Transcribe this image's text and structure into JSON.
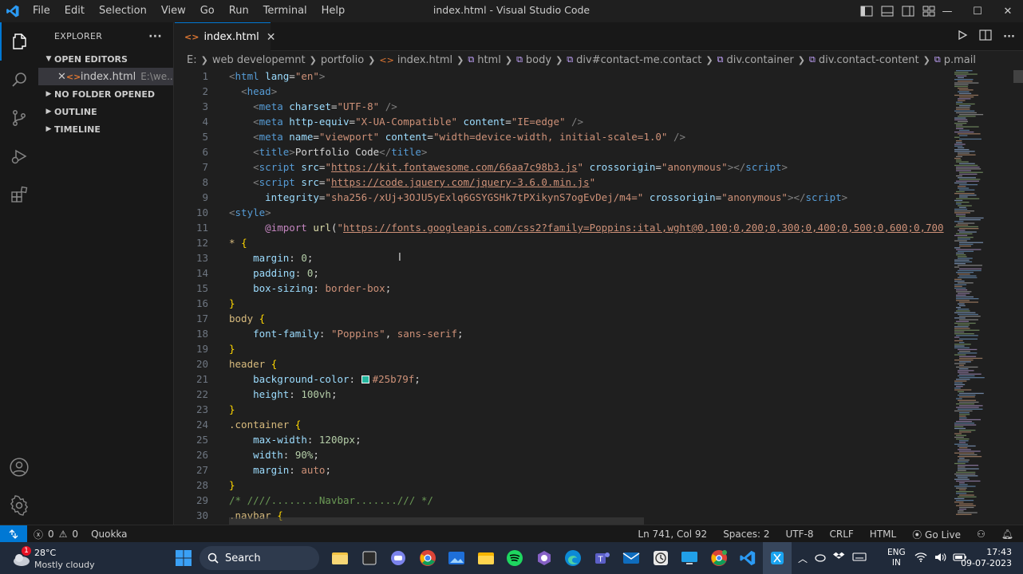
{
  "window": {
    "title": "index.html - Visual Studio Code",
    "menu": [
      "File",
      "Edit",
      "Selection",
      "View",
      "Go",
      "Run",
      "Terminal",
      "Help"
    ],
    "controls": {
      "minimize": "—",
      "maximize": "☐",
      "close": "✕"
    }
  },
  "sidebar": {
    "header": "EXPLORER",
    "more": "···",
    "open_editors": "OPEN EDITORS",
    "open_file": {
      "name": "index.html",
      "path": "E:\\we..."
    },
    "sections": [
      "NO FOLDER OPENED",
      "OUTLINE",
      "TIMELINE"
    ]
  },
  "tab": {
    "name": "index.html",
    "close": "✕"
  },
  "breadcrumb": [
    "E:",
    "web developemnt",
    "portfolio",
    "index.html",
    "html",
    "body",
    "div#contact-me.contact",
    "div.container",
    "div.contact-content",
    "p.mail"
  ],
  "editor": {
    "line_numbers": [
      "1",
      "2",
      "3",
      "4",
      "5",
      "6",
      "7",
      "8",
      "9",
      "10",
      "11",
      "12",
      "13",
      "14",
      "15",
      "16",
      "17",
      "18",
      "19",
      "20",
      "21",
      "22",
      "23",
      "24",
      "25",
      "26",
      "27",
      "28",
      "29",
      "30"
    ],
    "code": [
      [
        [
          "tb",
          "<"
        ],
        [
          "tg",
          "html"
        ],
        [
          "tx",
          " "
        ],
        [
          "at",
          "lang"
        ],
        [
          "tx",
          "="
        ],
        [
          "st",
          "\"en\""
        ],
        [
          "tb",
          ">"
        ]
      ],
      [
        [
          "tx",
          "  "
        ],
        [
          "tb",
          "<"
        ],
        [
          "tg",
          "head"
        ],
        [
          "tb",
          ">"
        ]
      ],
      [
        [
          "tx",
          "    "
        ],
        [
          "tb",
          "<"
        ],
        [
          "tg",
          "meta"
        ],
        [
          "tx",
          " "
        ],
        [
          "at",
          "charset"
        ],
        [
          "tx",
          "="
        ],
        [
          "st",
          "\"UTF-8\""
        ],
        [
          "tx",
          " "
        ],
        [
          "tb",
          "/>"
        ]
      ],
      [
        [
          "tx",
          "    "
        ],
        [
          "tb",
          "<"
        ],
        [
          "tg",
          "meta"
        ],
        [
          "tx",
          " "
        ],
        [
          "at",
          "http-equiv"
        ],
        [
          "tx",
          "="
        ],
        [
          "st",
          "\"X-UA-Compatible\""
        ],
        [
          "tx",
          " "
        ],
        [
          "at",
          "content"
        ],
        [
          "tx",
          "="
        ],
        [
          "st",
          "\"IE=edge\""
        ],
        [
          "tx",
          " "
        ],
        [
          "tb",
          "/>"
        ]
      ],
      [
        [
          "tx",
          "    "
        ],
        [
          "tb",
          "<"
        ],
        [
          "tg",
          "meta"
        ],
        [
          "tx",
          " "
        ],
        [
          "at",
          "name"
        ],
        [
          "tx",
          "="
        ],
        [
          "st",
          "\"viewport\""
        ],
        [
          "tx",
          " "
        ],
        [
          "at",
          "content"
        ],
        [
          "tx",
          "="
        ],
        [
          "st",
          "\"width=device-width, initial-scale=1.0\""
        ],
        [
          "tx",
          " "
        ],
        [
          "tb",
          "/>"
        ]
      ],
      [
        [
          "tx",
          "    "
        ],
        [
          "tb",
          "<"
        ],
        [
          "tg",
          "title"
        ],
        [
          "tb",
          ">"
        ],
        [
          "tx",
          "Portfolio Code"
        ],
        [
          "tb",
          "</"
        ],
        [
          "tg",
          "title"
        ],
        [
          "tb",
          ">"
        ]
      ],
      [
        [
          "tx",
          "    "
        ],
        [
          "tb",
          "<"
        ],
        [
          "tg",
          "script"
        ],
        [
          "tx",
          " "
        ],
        [
          "at",
          "src"
        ],
        [
          "tx",
          "="
        ],
        [
          "st",
          "\""
        ],
        [
          "lk",
          "https://kit.fontawesome.com/66aa7c98b3.js"
        ],
        [
          "st",
          "\""
        ],
        [
          "tx",
          " "
        ],
        [
          "at",
          "crossorigin"
        ],
        [
          "tx",
          "="
        ],
        [
          "st",
          "\"anonymous\""
        ],
        [
          "tb",
          "></"
        ],
        [
          "tg",
          "script"
        ],
        [
          "tb",
          ">"
        ]
      ],
      [
        [
          "tx",
          "    "
        ],
        [
          "tb",
          "<"
        ],
        [
          "tg",
          "script"
        ],
        [
          "tx",
          " "
        ],
        [
          "at",
          "src"
        ],
        [
          "tx",
          "="
        ],
        [
          "st",
          "\""
        ],
        [
          "lk",
          "https://code.jquery.com/jquery-3.6.0.min.js"
        ],
        [
          "st",
          "\""
        ]
      ],
      [
        [
          "tx",
          "      "
        ],
        [
          "at",
          "integrity"
        ],
        [
          "tx",
          "="
        ],
        [
          "st",
          "\"sha256-/xUj+3OJU5yExlq6GSYGSHk7tPXikynS7ogEvDej/m4=\""
        ],
        [
          "tx",
          " "
        ],
        [
          "at",
          "crossorigin"
        ],
        [
          "tx",
          "="
        ],
        [
          "st",
          "\"anonymous\""
        ],
        [
          "tb",
          "></"
        ],
        [
          "tg",
          "script"
        ],
        [
          "tb",
          ">"
        ]
      ],
      [
        [
          "tb",
          "<"
        ],
        [
          "tg",
          "style"
        ],
        [
          "tb",
          ">"
        ]
      ],
      [
        [
          "tx",
          "      "
        ],
        [
          "im",
          "@import"
        ],
        [
          "tx",
          " "
        ],
        [
          "fn",
          "url"
        ],
        [
          "tx",
          "("
        ],
        [
          "st",
          "\""
        ],
        [
          "lk",
          "https://fonts.googleapis.com/css2?family=Poppins:ital,wght@0,100;0,200;0,300;0,400;0,500;0,600;0,700"
        ]
      ],
      [
        [
          "sl",
          "*"
        ],
        [
          "tx",
          " "
        ],
        [
          "br",
          "{"
        ]
      ],
      [
        [
          "tx",
          "    "
        ],
        [
          "pr",
          "margin"
        ],
        [
          "tx",
          ": "
        ],
        [
          "nm",
          "0"
        ],
        [
          "tx",
          ";"
        ]
      ],
      [
        [
          "tx",
          "    "
        ],
        [
          "pr",
          "padding"
        ],
        [
          "tx",
          ": "
        ],
        [
          "nm",
          "0"
        ],
        [
          "tx",
          ";"
        ]
      ],
      [
        [
          "tx",
          "    "
        ],
        [
          "pr",
          "box-sizing"
        ],
        [
          "tx",
          ": "
        ],
        [
          "st",
          "border-box"
        ],
        [
          "tx",
          ";"
        ]
      ],
      [
        [
          "br",
          "}"
        ]
      ],
      [
        [
          "sl",
          "body"
        ],
        [
          "tx",
          " "
        ],
        [
          "br",
          "{"
        ]
      ],
      [
        [
          "tx",
          "    "
        ],
        [
          "pr",
          "font-family"
        ],
        [
          "tx",
          ": "
        ],
        [
          "st",
          "\"Poppins\""
        ],
        [
          "tx",
          ", "
        ],
        [
          "st",
          "sans-serif"
        ],
        [
          "tx",
          ";"
        ]
      ],
      [
        [
          "br",
          "}"
        ]
      ],
      [
        [
          "sl",
          "header"
        ],
        [
          "tx",
          " "
        ],
        [
          "br",
          "{"
        ]
      ],
      [
        [
          "tx",
          "    "
        ],
        [
          "pr",
          "background-color"
        ],
        [
          "tx",
          ": "
        ],
        [
          "sw",
          ""
        ],
        [
          "st",
          "#25b79f"
        ],
        [
          "tx",
          ";"
        ]
      ],
      [
        [
          "tx",
          "    "
        ],
        [
          "pr",
          "height"
        ],
        [
          "tx",
          ": "
        ],
        [
          "nm",
          "100vh"
        ],
        [
          "tx",
          ";"
        ]
      ],
      [
        [
          "br",
          "}"
        ]
      ],
      [
        [
          "sl",
          ".container"
        ],
        [
          "tx",
          " "
        ],
        [
          "br",
          "{"
        ]
      ],
      [
        [
          "tx",
          "    "
        ],
        [
          "pr",
          "max-width"
        ],
        [
          "tx",
          ": "
        ],
        [
          "nm",
          "1200px"
        ],
        [
          "tx",
          ";"
        ]
      ],
      [
        [
          "tx",
          "    "
        ],
        [
          "pr",
          "width"
        ],
        [
          "tx",
          ": "
        ],
        [
          "nm",
          "90%"
        ],
        [
          "tx",
          ";"
        ]
      ],
      [
        [
          "tx",
          "    "
        ],
        [
          "pr",
          "margin"
        ],
        [
          "tx",
          ": "
        ],
        [
          "st",
          "auto"
        ],
        [
          "tx",
          ";"
        ]
      ],
      [
        [
          "br",
          "}"
        ]
      ],
      [
        [
          "cm",
          "/* ////........Navbar......./// */"
        ]
      ],
      [
        [
          "sl",
          ".navbar"
        ],
        [
          "tx",
          " "
        ],
        [
          "br",
          "{"
        ]
      ]
    ]
  },
  "statusbar": {
    "errors": "0",
    "warnings": "0",
    "extension": "Quokka",
    "position": "Ln 741, Col 92",
    "spaces": "Spaces: 2",
    "encoding": "UTF-8",
    "eol": "CRLF",
    "language": "HTML",
    "golive": "Go Live"
  },
  "taskbar": {
    "weather_temp": "28°C",
    "weather_desc": "Mostly cloudy",
    "weather_badge": "1",
    "search": "Search",
    "lang_top": "ENG",
    "lang_bottom": "IN",
    "time": "17:43",
    "date": "09-07-2023"
  },
  "colors": {
    "accent": "#0078d4",
    "swatch": "#25b79f"
  }
}
